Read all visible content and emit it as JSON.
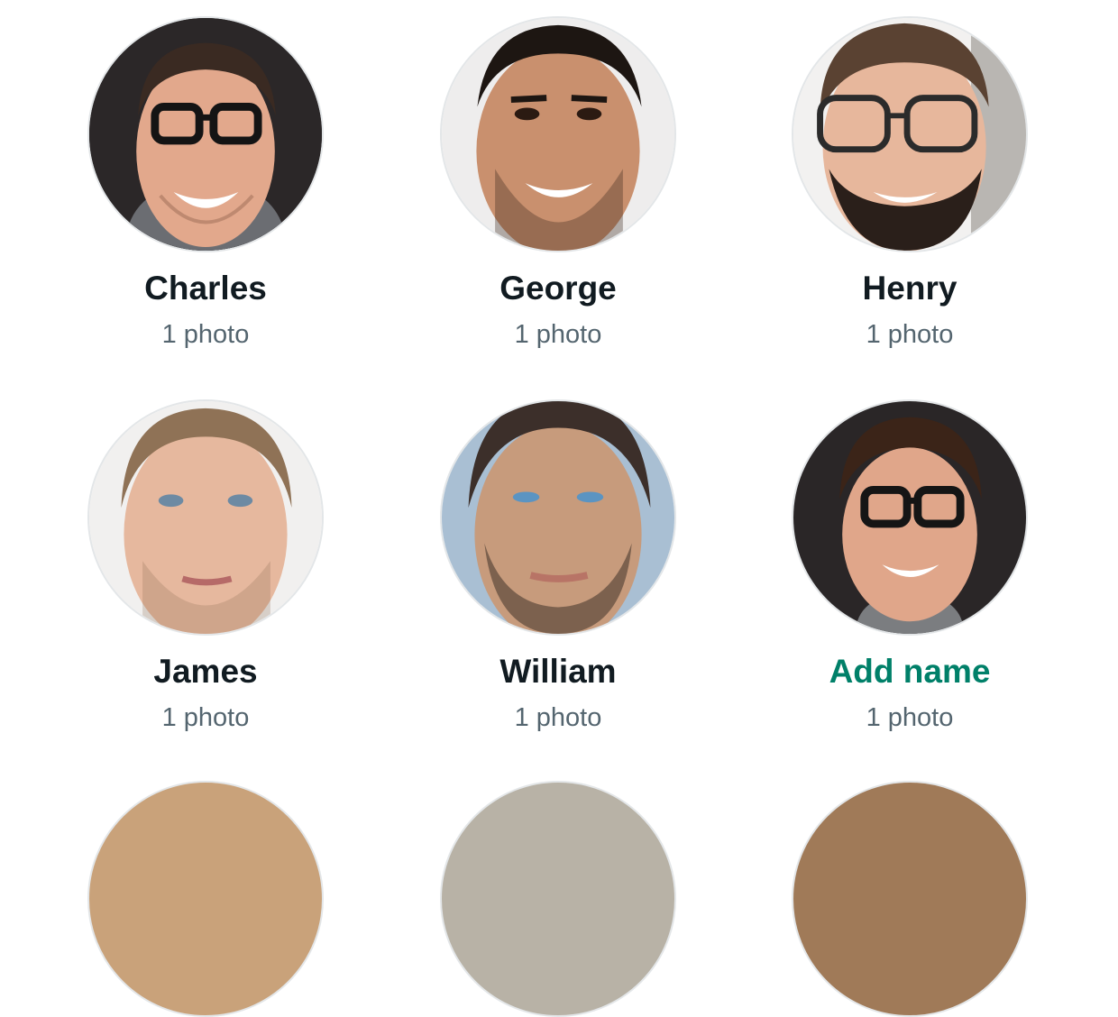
{
  "people": [
    {
      "name": "Charles",
      "count": "1 photo",
      "named": true
    },
    {
      "name": "George",
      "count": "1 photo",
      "named": true
    },
    {
      "name": "Henry",
      "count": "1 photo",
      "named": true
    },
    {
      "name": "James",
      "count": "1 photo",
      "named": true
    },
    {
      "name": "William",
      "count": "1 photo",
      "named": true
    },
    {
      "name": "Add name",
      "count": "1 photo",
      "named": false
    }
  ],
  "colors": {
    "name_text": "#111b21",
    "add_name_accent": "#008069",
    "count_text": "#54656f"
  }
}
